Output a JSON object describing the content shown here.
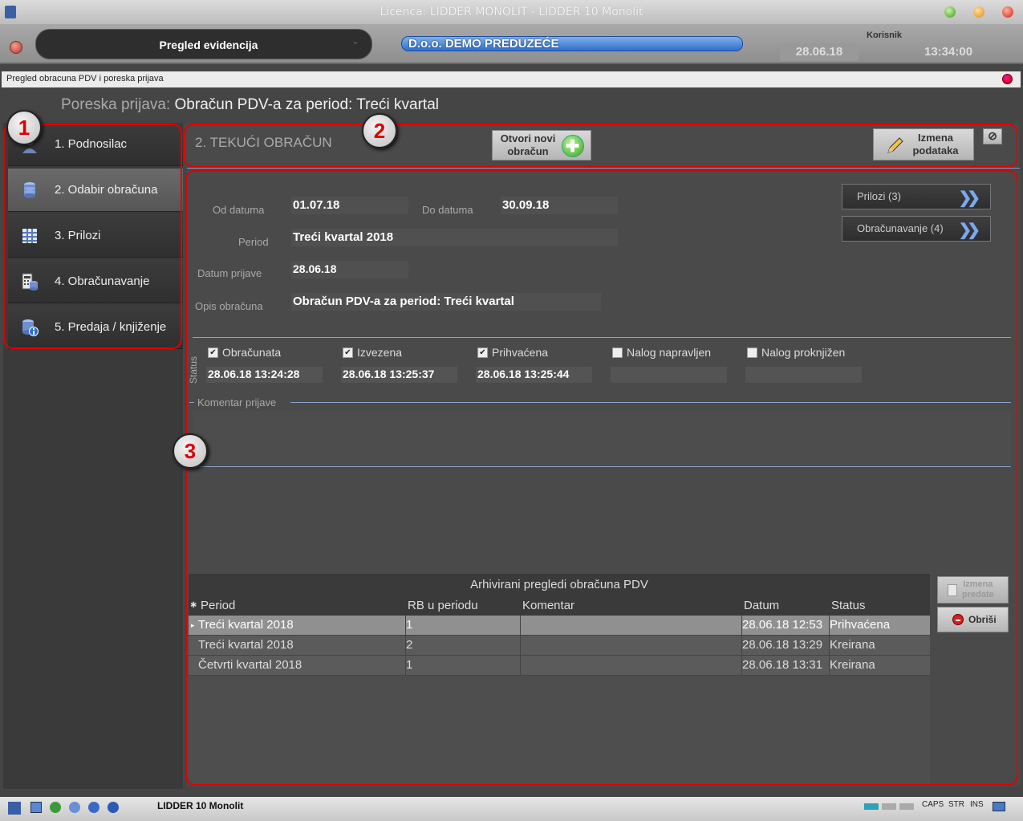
{
  "window": {
    "title": "Licenca: LIDDER MONOLIT - LIDDER 10 Monolit"
  },
  "header": {
    "module": "Pregled evidencija",
    "module_dash": "-",
    "company": "D.o.o. DEMO PREDUZEĆE",
    "date": "28.06.18",
    "user_label": "Korisnik",
    "time": "13:34:00"
  },
  "inner_window": {
    "title": "Pregled obracuna PDV i poreska prijava"
  },
  "page": {
    "heading_prefix": "Poreska prijava:",
    "heading": "Obračun PDV-a za period: Treći kvartal"
  },
  "sidebar": {
    "items": [
      {
        "label": "1. Podnosilac",
        "icon": "person-icon"
      },
      {
        "label": "2. Odabir obračuna",
        "icon": "database-icon",
        "active": true
      },
      {
        "label": "3. Prilozi",
        "icon": "grid-icon"
      },
      {
        "label": "4. Obračunavanje",
        "icon": "calculator-icon"
      },
      {
        "label": "5. Predaja / knjiženje",
        "icon": "database-info-icon"
      }
    ]
  },
  "section": {
    "title": "2. TEKUĆI OBRAČUN",
    "new_btn_line1": "Otvori novi",
    "new_btn_line2": "obračun",
    "edit_btn_line1": "Izmena",
    "edit_btn_line2": "podataka",
    "stop_btn": "⊘"
  },
  "form": {
    "od_label": "Od datuma",
    "od_value": "01.07.18",
    "do_label": "Do datuma",
    "do_value": "30.09.18",
    "period_label": "Period",
    "period_value": "Treći kvartal 2018",
    "datum_label": "Datum prijave",
    "datum_value": "28.06.18",
    "opis_label": "Opis obračuna",
    "opis_value": "Obračun PDV-a za period: Treći kvartal"
  },
  "side_buttons": {
    "prilozi": "Prilozi (3)",
    "obracunavanje": "Obračunavanje (4)"
  },
  "status": {
    "label": "Status",
    "items": [
      {
        "label": "Obračunata",
        "checked": true,
        "value": "28.06.18 13:24:28"
      },
      {
        "label": "Izvezena",
        "checked": true,
        "value": "28.06.18 13:25:37"
      },
      {
        "label": "Prihvaćena",
        "checked": true,
        "value": "28.06.18 13:25:44"
      },
      {
        "label": "Nalog napravljen",
        "checked": false,
        "value": ""
      },
      {
        "label": "Nalog proknjižen",
        "checked": false,
        "value": ""
      }
    ]
  },
  "komentar": {
    "label": "Komentar prijave"
  },
  "archive": {
    "title": "Arhivirani pregledi obračuna PDV",
    "columns": [
      "Period",
      "RB u periodu",
      "Komentar",
      "Datum",
      "Status"
    ],
    "rows": [
      {
        "period": "Treći kvartal 2018",
        "rb": "1",
        "komentar": "",
        "datum": "28.06.18 12:53",
        "status": "Prihvaćena"
      },
      {
        "period": "Treći kvartal 2018",
        "rb": "2",
        "komentar": "",
        "datum": "28.06.18 13:29",
        "status": "Kreirana"
      },
      {
        "period": "Četvrti kvartal 2018",
        "rb": "1",
        "komentar": "",
        "datum": "28.06.18 13:31",
        "status": "Kreirana"
      }
    ],
    "btn_izmena_line1": "Izmena",
    "btn_izmena_line2": "predate",
    "btn_obrisi": "Obriši"
  },
  "statusbar": {
    "app": "LIDDER 10 Monolit",
    "caps": "CAPS",
    "str": "STR",
    "ins": "INS"
  },
  "annotations": {
    "badge1": "1",
    "badge2": "2",
    "badge3": "3"
  },
  "colors": {
    "annotation": "#e00000",
    "accent_blue": "#2f6fcf"
  }
}
